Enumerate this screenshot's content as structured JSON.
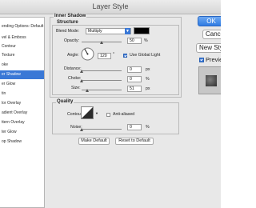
{
  "window": {
    "title": "Layer Style"
  },
  "sidebar": {
    "items": [
      {
        "label": "ending Options: Default",
        "active": false
      },
      {
        "label": "vel & Emboss",
        "active": false
      },
      {
        "label": "Contour",
        "active": false
      },
      {
        "label": "Texture",
        "active": false
      },
      {
        "label": "oke",
        "active": false
      },
      {
        "label": "er Shadow",
        "active": true
      },
      {
        "label": "er Glow",
        "active": false
      },
      {
        "label": "tin",
        "active": false
      },
      {
        "label": "lor Overlay",
        "active": false
      },
      {
        "label": "adient Overlay",
        "active": false
      },
      {
        "label": "ttern Overlay",
        "active": false
      },
      {
        "label": "ter Glow",
        "active": false
      },
      {
        "label": "op Shadow",
        "active": false
      }
    ]
  },
  "panel": {
    "title": "Inner Shadow",
    "structure": {
      "legend": "Structure",
      "blend_mode_label": "Blend Mode:",
      "blend_mode_value": "Multiply",
      "shadow_color": "#000000",
      "opacity_label": "Opacity:",
      "opacity_value": "50",
      "opacity_fraction": 0.5,
      "angle_label": "Angle:",
      "angle_value": "120",
      "use_global_light_label": "Use Global Light",
      "use_global_light_checked": true,
      "distance_label": "Distance:",
      "distance_value": "0",
      "choke_label": "Choke:",
      "choke_value": "0",
      "size_label": "Size:",
      "size_value": "51",
      "percent_unit": "%",
      "px_unit": "px",
      "degree_unit": "°"
    },
    "quality": {
      "legend": "Quality",
      "contour_label": "Contour:",
      "anti_aliased_label": "Anti-aliased",
      "anti_aliased_checked": false,
      "noise_label": "Noise:",
      "noise_value": "0",
      "percent_unit": "%"
    },
    "make_default_label": "Make Default",
    "reset_default_label": "Reset to Default"
  },
  "buttons": {
    "ok": "OK",
    "cancel": "Cancel",
    "new_style": "New Style",
    "preview": "Preview",
    "preview_checked": true
  }
}
